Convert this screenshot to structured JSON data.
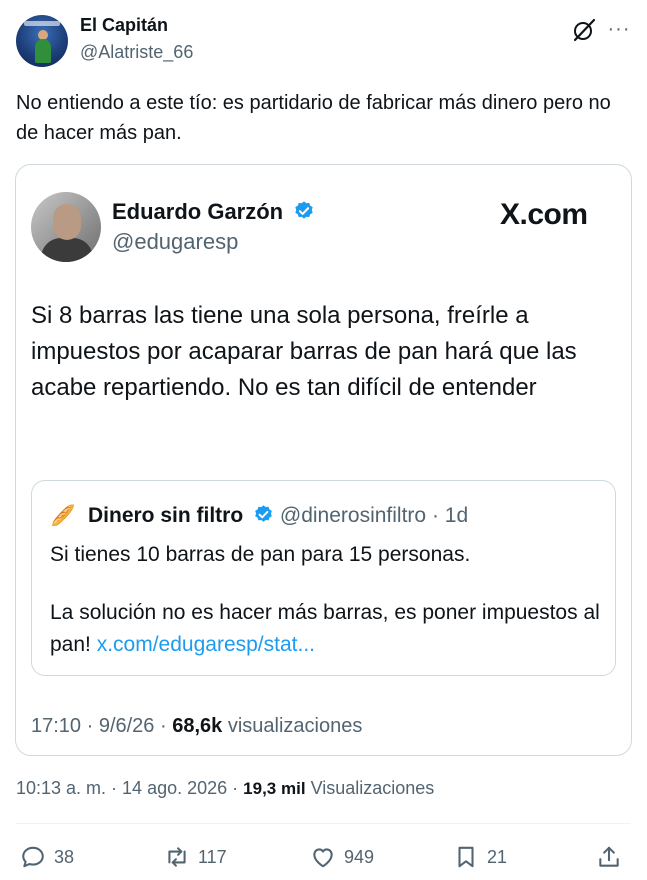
{
  "author": {
    "name": "El Capitán",
    "handle": "@Alatriste_66",
    "avatar_icon": "profile-photo"
  },
  "tweet": {
    "text": "No entiendo a este tío: es partidario de fabricar más dinero pero no de hacer más pan."
  },
  "quoted": {
    "name": "Eduardo Garzón",
    "handle": "@edugaresp",
    "verified": true,
    "source_logo": "X.com",
    "text": "Si 8 barras las tiene una sola persona, freírle a impuestos por acaparar barras de pan hará que las acabe repartiendo. No es tan difícil de entender",
    "inner": {
      "avatar_icon": "🥖",
      "name": "Dinero sin filtro",
      "handle": "@dinerosinfiltro",
      "time": "· 1d",
      "text_line1": "Si tienes 10 barras de pan para 15 personas.",
      "text_line2": "La solución no es hacer más barras, es poner impuestos al pan!",
      "link": "x.com/edugaresp/stat..."
    },
    "timestamp": "17:10 · 9/6/26 ·",
    "views_count": "68,6k",
    "views_label": "visualizaciones"
  },
  "meta": {
    "timestamp": "10:13 a. m. · 14 ago. 2026 ·",
    "views_count": "19,3 mil",
    "views_label": "Visualizaciones"
  },
  "actions": {
    "replies": "38",
    "reposts": "117",
    "likes": "949",
    "bookmarks": "21"
  },
  "colors": {
    "text": "#0f1419",
    "secondary": "#536471",
    "link": "#1d9bf0",
    "border": "#cfd9de"
  }
}
